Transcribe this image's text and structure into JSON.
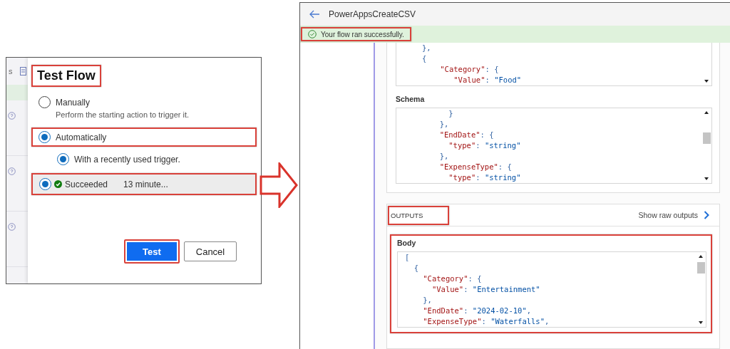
{
  "left_panel": {
    "background_app": {
      "label": "s"
    },
    "dialog": {
      "title": {
        "text": "Test Flow",
        "highlighted": true
      },
      "options": [
        {
          "label": "Manually",
          "description": "Perform the starting action to trigger it.",
          "selected": false,
          "highlighted": false
        },
        {
          "label": "Automatically",
          "selected": true,
          "highlighted": true
        }
      ],
      "trigger_option": {
        "label": "With a recently used trigger.",
        "selected": true
      },
      "runs": [
        {
          "status": "Succeeded",
          "time": "13 minute...",
          "selected": true,
          "highlighted": true
        }
      ],
      "buttons": [
        {
          "label": "Test",
          "kind": "primary",
          "highlighted": true
        },
        {
          "label": "Cancel",
          "kind": "secondary",
          "highlighted": false
        }
      ]
    }
  },
  "right_panel": {
    "title": "PowerAppsCreateCSV",
    "banner": {
      "text": "Your flow ran successfully.",
      "highlighted": true
    },
    "inputs": {
      "code": [
        "},",
        "{",
        "    \"Category\": {",
        "       \"Value\": \"Food\""
      ],
      "schema": {
        "label": "Schema",
        "code": [
          "    }",
          "  },",
          "  \"EndDate\": {",
          "    \"type\": \"string\"",
          "  },",
          "  \"ExpenseType\": {",
          "    \"type\": \"string\""
        ]
      }
    },
    "outputs": {
      "heading": "OUTPUTS",
      "heading_highlighted": true,
      "link": "Show raw outputs",
      "body": {
        "label": "Body",
        "highlighted": true,
        "code": [
          "[",
          "  {",
          "    \"Category\": {",
          "      \"Value\": \"Entertainment\"",
          "    },",
          "    \"EndDate\": \"2024-02-10\",",
          "    \"ExpenseType\": \"Waterfalls\","
        ]
      }
    }
  }
}
